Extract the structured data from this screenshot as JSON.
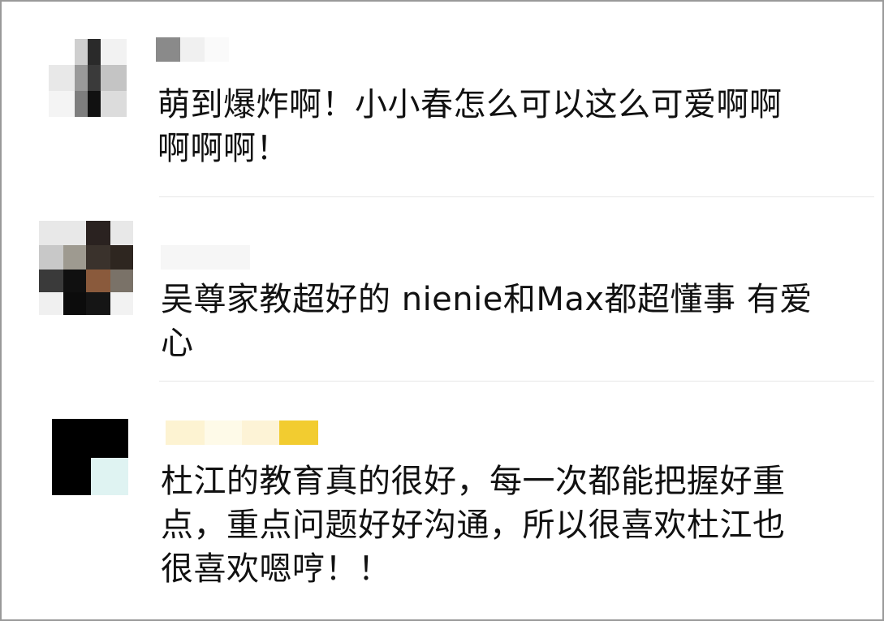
{
  "comments": [
    {
      "avatar": "pixelated-avatar",
      "username": "",
      "text": "萌到爆炸啊！小小春怎么可以这么可爱啊啊\n啊啊啊！"
    },
    {
      "avatar": "pixelated-avatar",
      "username": "",
      "text": "吴尊家教超好的 nienie和Max都超懂事 有爱\n心"
    },
    {
      "avatar": "pixelated-avatar",
      "username": "",
      "text": "杜江的教育真的很好，每一次都能把握好重\n点，重点问题好好沟通，所以很喜欢杜江也\n很喜欢嗯哼！！"
    }
  ]
}
